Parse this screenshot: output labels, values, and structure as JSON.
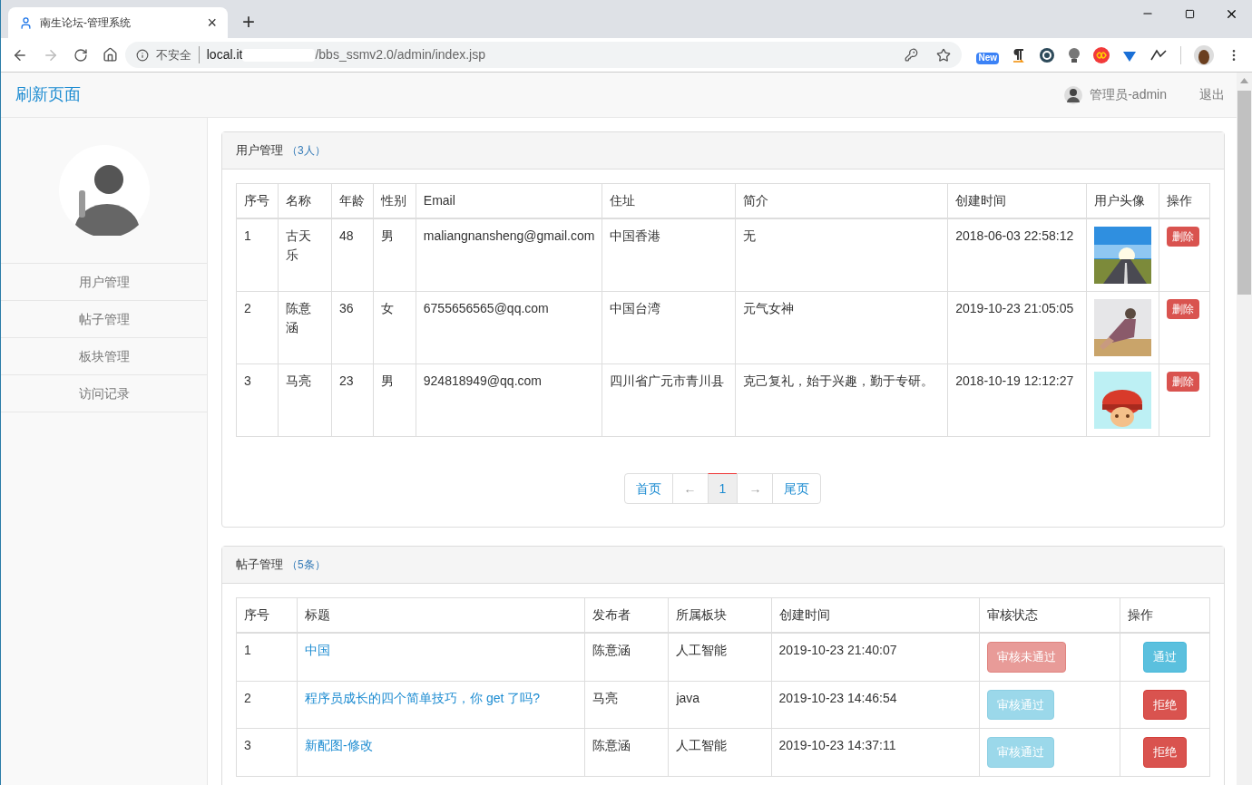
{
  "browser": {
    "tab": {
      "title": "南生论坛-管理系统",
      "close": "×"
    },
    "new_tab": "+",
    "security": "不安全",
    "url": [
      "local.it",
      "/bbs_ssmv2.0/admin/index.jsp"
    ],
    "extension_badge": "New"
  },
  "navbar": {
    "brand": "刷新页面",
    "user": "管理员-admin",
    "logout": "退出"
  },
  "sidebar": {
    "items": [
      {
        "label": "用户管理",
        "selected": false
      },
      {
        "label": "帖子管理",
        "selected": false
      },
      {
        "label": "板块管理",
        "selected": false
      },
      {
        "label": "访问记录",
        "selected": false
      }
    ]
  },
  "user_panel": {
    "title": "用户管理",
    "count": "（3人）",
    "columns": [
      "序号",
      "名称",
      "年龄",
      "性别",
      "Email",
      "住址",
      "简介",
      "创建时间",
      "用户头像",
      "操作"
    ],
    "rows": [
      {
        "cells": [
          "1",
          "古天乐",
          "48",
          "男",
          "maliangnansheng@gmail.com",
          "中国香港",
          "无",
          "2018-06-03 22:58:12"
        ],
        "action": "删除"
      },
      {
        "cells": [
          "2",
          "陈意涵",
          "36",
          "女",
          "6755656565@qq.com",
          "中国台湾",
          "元气女神",
          "2019-10-23 21:05:05"
        ],
        "action": "删除"
      },
      {
        "cells": [
          "3",
          "马亮",
          "23",
          "男",
          "924818949@qq.com",
          "四川省广元市青川县",
          "克己复礼，始于兴趣，勤于专研。",
          "2018-10-19 12:12:27"
        ],
        "action": "删除"
      }
    ],
    "pagination": [
      {
        "label": "首页",
        "selected": false,
        "disabled": false
      },
      {
        "label": "←",
        "selected": false,
        "disabled": true
      },
      {
        "label": "1",
        "selected": true,
        "disabled": false
      },
      {
        "label": "→",
        "selected": false,
        "disabled": true
      },
      {
        "label": "尾页",
        "selected": false,
        "disabled": false
      }
    ]
  },
  "post_panel": {
    "title": "帖子管理",
    "count": "（5条）",
    "columns": [
      "序号",
      "标题",
      "发布者",
      "所属板块",
      "创建时间",
      "审核状态",
      "操作"
    ],
    "rows": [
      {
        "cells": [
          "1",
          "中国",
          "陈意涵",
          "人工智能",
          "2019-10-23 21:40:07"
        ],
        "status": {
          "label": "审核未通过",
          "kind": "rejected"
        },
        "action": {
          "label": "通过",
          "kind": "approve"
        }
      },
      {
        "cells": [
          "2",
          "程序员成长的四个简单技巧，你 get 了吗?",
          "马亮",
          "java",
          "2019-10-23 14:46:54"
        ],
        "status": {
          "label": "审核通过",
          "kind": "approved"
        },
        "action": {
          "label": "拒绝",
          "kind": "reject"
        }
      },
      {
        "cells": [
          "3",
          "新配图-修改",
          "陈意涵",
          "人工智能",
          "2019-10-23 14:37:11"
        ],
        "status": {
          "label": "审核通过",
          "kind": "approved"
        },
        "action": {
          "label": "拒绝",
          "kind": "reject"
        }
      }
    ]
  }
}
